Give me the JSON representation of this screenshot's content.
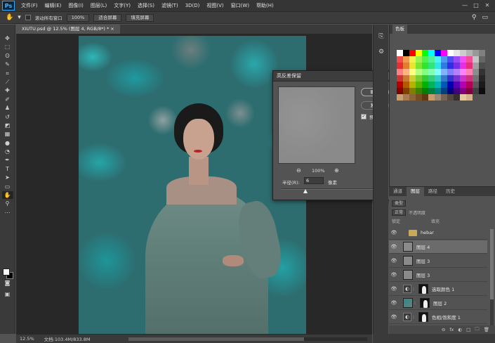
{
  "app": {
    "logo": "Ps"
  },
  "menu": [
    "文件(F)",
    "编辑(E)",
    "图像(I)",
    "图层(L)",
    "文字(Y)",
    "选择(S)",
    "滤镜(T)",
    "3D(D)",
    "视图(V)",
    "窗口(W)",
    "帮助(H)"
  ],
  "window_controls": [
    "—",
    "□",
    "✕"
  ],
  "options": {
    "scroll_all_label": "滚动所有窗口",
    "zoom_value": "100%",
    "fit_screen": "适合屏幕",
    "fill_screen": "填充屏幕"
  },
  "document": {
    "tab": "XIUTU.psd @ 12.5% (图层 4, RGB/8*) *  ×"
  },
  "dialog": {
    "title": "高反差保留",
    "close": "✕",
    "ok": "确定",
    "reset": "复位",
    "preview_label": "预览(P)",
    "preview_checked": "✓",
    "zoom": "100%",
    "zoom_out": "⊖",
    "zoom_in": "⊕",
    "radius_label": "半径(R):",
    "radius_value": "6",
    "radius_unit": "像素",
    "radius_slider_fraction": 0.26
  },
  "swatches": {
    "tab": "色板",
    "rows": [
      [
        "#ffffff",
        "#000000",
        "#ff0000",
        "#ffff00",
        "#00ff00",
        "#00ffff",
        "#0000ff",
        "#ff00ff",
        "#ffffff",
        "#e6e6e6",
        "#cccccc",
        "#b3b3b3",
        "#999999",
        "#808080"
      ],
      [
        "#f24d4d",
        "#f2994d",
        "#f2f24d",
        "#99f24d",
        "#4df24d",
        "#4df299",
        "#4df2f2",
        "#4d99f2",
        "#4d4df2",
        "#994df2",
        "#f24df2",
        "#f24d99",
        "#c4c4c4",
        "#666666"
      ],
      [
        "#e62e2e",
        "#e67a2e",
        "#e6e62e",
        "#7ae62e",
        "#2ee62e",
        "#2ee67a",
        "#2ee6e6",
        "#2e7ae6",
        "#2e2ee6",
        "#7a2ee6",
        "#e62ee6",
        "#e62e7a",
        "#a0a0a0",
        "#4d4d4d"
      ],
      [
        "#ff8080",
        "#ffb380",
        "#ffff80",
        "#b3ff80",
        "#80ff80",
        "#80ffb3",
        "#80ffff",
        "#80b3ff",
        "#8080ff",
        "#b380ff",
        "#ff80ff",
        "#ff80b3",
        "#8c8c8c",
        "#333333"
      ],
      [
        "#cc3333",
        "#cc7a33",
        "#cccc33",
        "#7acc33",
        "#33cc33",
        "#33cc7a",
        "#33cccc",
        "#337acc",
        "#3333cc",
        "#7a33cc",
        "#cc33cc",
        "#cc337a",
        "#737373",
        "#262626"
      ],
      [
        "#b30000",
        "#b35900",
        "#b3b300",
        "#59b300",
        "#00b300",
        "#00b359",
        "#00b3b3",
        "#0059b3",
        "#0000b3",
        "#5900b3",
        "#b300b3",
        "#b30059",
        "#595959",
        "#1a1a1a"
      ],
      [
        "#800000",
        "#804000",
        "#808000",
        "#408000",
        "#008000",
        "#008040",
        "#008080",
        "#004080",
        "#000080",
        "#400080",
        "#800080",
        "#800040",
        "#404040",
        "#0d0d0d"
      ],
      [
        "#c8a070",
        "#a67c52",
        "#8c6239",
        "#754c24",
        "#603913",
        "#c69c6d",
        "#998675",
        "#736357",
        "#534741",
        "#362f2d",
        "#e5c7a0",
        "#d4b28c",
        "",
        ""
      ]
    ]
  },
  "layers": {
    "tabs": [
      "通道",
      "图层",
      "路径",
      "历史"
    ],
    "kind_label": "类型",
    "blend_label": "正常",
    "opacity_label": "不透明度",
    "lock_label": "锁定",
    "fill_label": "填充",
    "items": [
      {
        "name": "hebar",
        "type": "folder"
      },
      {
        "name": "图层 4",
        "type": "layer",
        "selected": true
      },
      {
        "name": "图层 3",
        "type": "layer"
      },
      {
        "name": "图层 3",
        "type": "layer"
      },
      {
        "name": "选取颜色 1",
        "type": "adjustment",
        "mask": true
      },
      {
        "name": "图层 2",
        "type": "photo",
        "mask": true
      },
      {
        "name": "色相/饱和度 1",
        "type": "adjustment",
        "mask": true
      },
      {
        "name": "图层 1",
        "type": "photo"
      }
    ],
    "footer_icons": [
      "⊖",
      "fx",
      "◐",
      "□",
      "🗀",
      "🗑"
    ]
  },
  "status": {
    "zoom": "12.5%",
    "doc": "文档:103.4M/833.8M"
  }
}
